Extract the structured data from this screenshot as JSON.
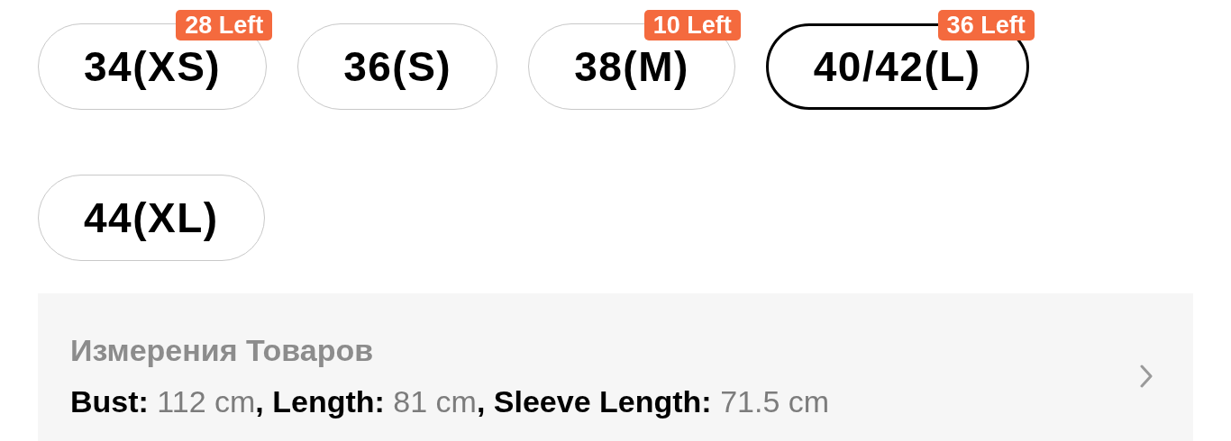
{
  "sizes": [
    {
      "label": "34(XS)",
      "stock": "28 Left",
      "selected": false
    },
    {
      "label": "36(S)",
      "selected": false
    },
    {
      "label": "38(M)",
      "stock": "10 Left",
      "selected": false
    },
    {
      "label": "40/42(L)",
      "stock": "36 Left",
      "selected": true
    },
    {
      "label": "44(XL)",
      "selected": false
    }
  ],
  "measurements_panel": {
    "title": "Измерения Товаров",
    "separator": ",",
    "items": [
      {
        "label": "Bust:",
        "value": "112 cm"
      },
      {
        "label": "Length:",
        "value": "81 cm"
      },
      {
        "label": "Sleeve Length:",
        "value": "71.5 cm"
      }
    ]
  }
}
